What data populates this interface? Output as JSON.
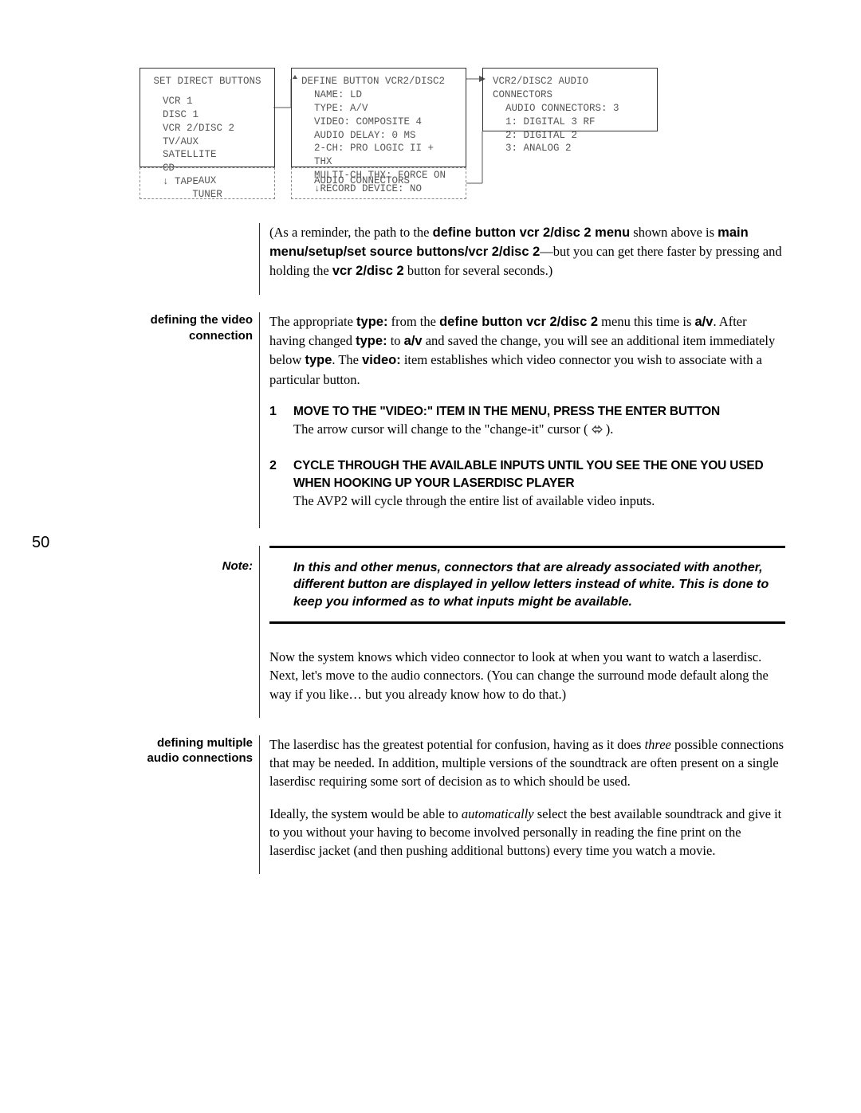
{
  "page_number": "50",
  "diagram": {
    "box1": {
      "title": "SET DIRECT BUTTONS",
      "items": [
        "VCR 1",
        "DISC 1",
        "VCR 2/DISC 2",
        "TV/AUX",
        "SATELLITE",
        "CD",
        "↓ TAPE"
      ]
    },
    "box2": {
      "title": "DEFINE BUTTON VCR2/DISC2",
      "items": [
        "NAME: LD",
        "TYPE: A/V",
        "VIDEO: COMPOSITE 4",
        "AUDIO DELAY: 0 MS",
        "2-CH: PRO LOGIC II + THX",
        "MULTI-CH THX: FORCE ON",
        "↓RECORD DEVICE: NO"
      ]
    },
    "box3": {
      "title": "VCR2/DISC2 AUDIO CONNECTORS",
      "items": [
        "AUDIO CONNECTORS: 3",
        "  1: DIGITAL 3 RF",
        "  2: DIGITAL 2",
        "  3: ANALOG 2"
      ]
    },
    "box4": {
      "items": [
        "AUX",
        "TUNER"
      ]
    },
    "box5": {
      "items": [
        "AUDIO CONNECTORS"
      ]
    }
  },
  "reminder_para": {
    "pre": "(As a reminder, the path to the ",
    "b1": "define button vcr 2/disc 2 menu",
    "mid1": " shown above is ",
    "b2": "main menu/setup/set source buttons/vcr 2/disc 2",
    "mid2": "—but you can get there faster by pressing and holding the ",
    "b3": "vcr 2/disc 2",
    "post": " button for several seconds.)"
  },
  "section1": {
    "heading": "defining the video connection",
    "para": {
      "t1": "The appropriate ",
      "b1": "type:",
      "t2": " from the ",
      "b2": "define button vcr 2/disc 2",
      "t3": " menu this time is ",
      "b3": "a/v",
      "t4": ". After having changed ",
      "b4": "type:",
      "t5": " to ",
      "b5": "a/v",
      "t6": " and saved the change, you will see an additional item immediately below ",
      "b6": "type",
      "t7": ". The ",
      "b7": "video:",
      "t8": " item establishes which video connector you wish to associate with a particular button."
    },
    "step1": {
      "num": "1",
      "title": "MOVE TO THE \"VIDEO:\" ITEM IN THE MENU, PRESS THE ENTER BUTTON",
      "body_pre": "The arrow cursor will change to the \"change-it\" cursor ( ",
      "body_post": " )."
    },
    "step2": {
      "num": "2",
      "title": "CYCLE THROUGH THE AVAILABLE INPUTS UNTIL YOU SEE THE ONE YOU USED WHEN HOOKING UP YOUR LASERDISC PLAYER",
      "body": "The AVP2 will cycle through the entire list of available video inputs."
    }
  },
  "note": {
    "label": "Note:",
    "text": "In this and other menus, connectors that are already associated with another, different button are displayed in yellow letters instead of white. This is done to keep you informed as to what inputs might be available."
  },
  "para_after_note": "Now the system knows which video connector to look at when you want to watch a laserdisc. Next, let's move to the audio connectors. (You can change the surround mode default along the way if you like… but you already know how to do that.)",
  "section2": {
    "heading1": "defining multiple",
    "heading2": "audio connections",
    "para1": {
      "t1": "The laserdisc has the greatest potential for confusion, having as it does ",
      "i1": "three",
      "t2": " possible connections that may be needed. In addition, multiple versions of the soundtrack are often present on a single laserdisc requiring some sort of decision as to which should be used."
    },
    "para2": {
      "t1": "Ideally, the system would be able to ",
      "i1": "automatically",
      "t2": " select the best available soundtrack and give it to you without your having to become involved personally in reading the fine print on the laserdisc jacket (and then pushing additional buttons) every time you watch a movie."
    }
  }
}
